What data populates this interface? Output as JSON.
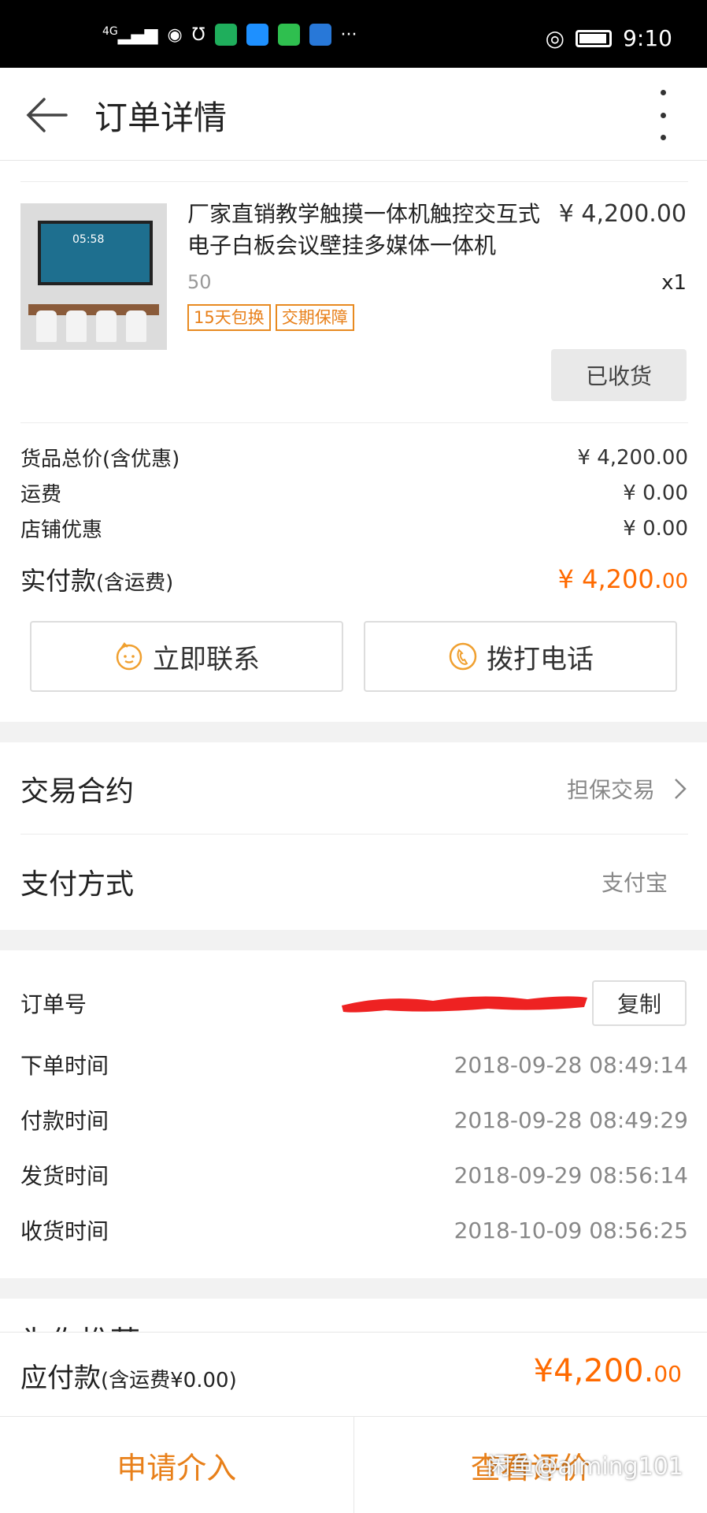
{
  "status_bar": {
    "network": "4G",
    "time": "9:10",
    "more": "···",
    "colors": {
      "app1": "#1fae5c",
      "app2": "#1e90ff",
      "app3": "#2fbf4f",
      "app4": "#2878d8"
    }
  },
  "header": {
    "title": "订单详情",
    "back_icon": "arrow-left-icon",
    "more_icon": "more-vertical-icon"
  },
  "product": {
    "name": "厂家直销教学触摸一体机触控交互式电子白板会议壁挂多媒体一体机",
    "price": "¥ 4,200.00",
    "sku": "50",
    "quantity": "x1",
    "tags": [
      "15天包换",
      "交期保障"
    ],
    "status_button": "已收货",
    "thumb_clock": "05:58"
  },
  "price_summary": {
    "goods_label": "货品总价(含优惠)",
    "goods_value": "¥ 4,200.00",
    "shipping_label": "运费",
    "shipping_value": "¥ 0.00",
    "shop_discount_label": "店铺优惠",
    "shop_discount_value": "¥ 0.00",
    "paid_label": "实付款",
    "paid_label_suffix": "(含运费)",
    "paid_value_main": "¥ 4,200.",
    "paid_value_cents": "00"
  },
  "contact_buttons": {
    "chat": "立即联系",
    "call": "拨打电话"
  },
  "trade": {
    "contract_label": "交易合约",
    "contract_value": "担保交易",
    "payment_label": "支付方式",
    "payment_value": "支付宝"
  },
  "order_info": {
    "order_no_label": "订单号",
    "copy_button": "复制",
    "rows": [
      {
        "label": "下单时间",
        "value": "2018-09-28 08:49:14"
      },
      {
        "label": "付款时间",
        "value": "2018-09-28 08:49:29"
      },
      {
        "label": "发货时间",
        "value": "2018-09-29 08:56:14"
      },
      {
        "label": "收货时间",
        "value": "2018-10-09 08:56:25"
      }
    ]
  },
  "recommend_title": "为你推荐",
  "bottom": {
    "due_label": "应付款",
    "due_label_suffix": "(含运费¥0.00)",
    "due_value_main": "¥4,200.",
    "due_value_cents": "00",
    "action_left": "申请介入",
    "action_right": "查看评价",
    "watermark": "闲鱼@aiming101"
  },
  "accent_color": "#ff6a00"
}
